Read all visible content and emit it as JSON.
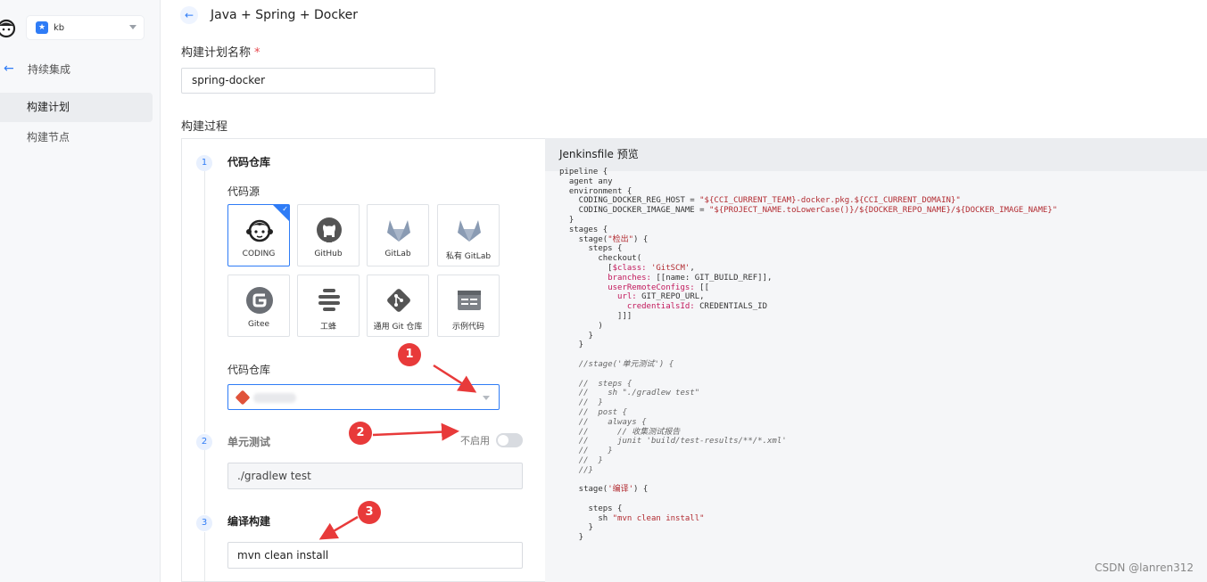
{
  "sidebar": {
    "project_name": "kb",
    "project_badge": "★",
    "back_label": "持续集成",
    "items": [
      {
        "label": "构建计划",
        "active": true
      },
      {
        "label": "构建节点",
        "active": false
      }
    ]
  },
  "header": {
    "title": "Java + Spring + Docker"
  },
  "form": {
    "name_label": "构建计划名称",
    "required_mark": "*",
    "name_value": "spring-docker",
    "process_label": "构建过程"
  },
  "steps": [
    {
      "num": "1",
      "title": "代码仓库"
    },
    {
      "num": "2",
      "title": "单元测试"
    },
    {
      "num": "3",
      "title": "编译构建"
    }
  ],
  "source": {
    "label": "代码源",
    "tiles": [
      {
        "label": "CODING",
        "icon": "coding-icon",
        "selected": true
      },
      {
        "label": "GitHub",
        "icon": "github-icon"
      },
      {
        "label": "GitLab",
        "icon": "gitlab-icon"
      },
      {
        "label": "私有 GitLab",
        "icon": "gitlab-private-icon"
      },
      {
        "label": "Gitee",
        "icon": "gitee-icon"
      },
      {
        "label": "工蜂",
        "icon": "gongfeng-icon"
      },
      {
        "label": "通用 Git 仓库",
        "icon": "git-icon"
      },
      {
        "label": "示例代码",
        "icon": "sample-code-icon"
      }
    ],
    "check_mark": "✓"
  },
  "repo": {
    "label": "代码仓库"
  },
  "unit_test": {
    "toggle_label": "不启用",
    "enabled": false,
    "command": "./gradlew test"
  },
  "compile": {
    "command": "mvn clean install"
  },
  "jenkins": {
    "title": "Jenkinsfile 预览"
  },
  "annotations": [
    "1",
    "2",
    "3"
  ],
  "watermark": "CSDN @lanren312",
  "colors": {
    "accent": "#2f7cf6",
    "annotation": "#e83a3a"
  }
}
